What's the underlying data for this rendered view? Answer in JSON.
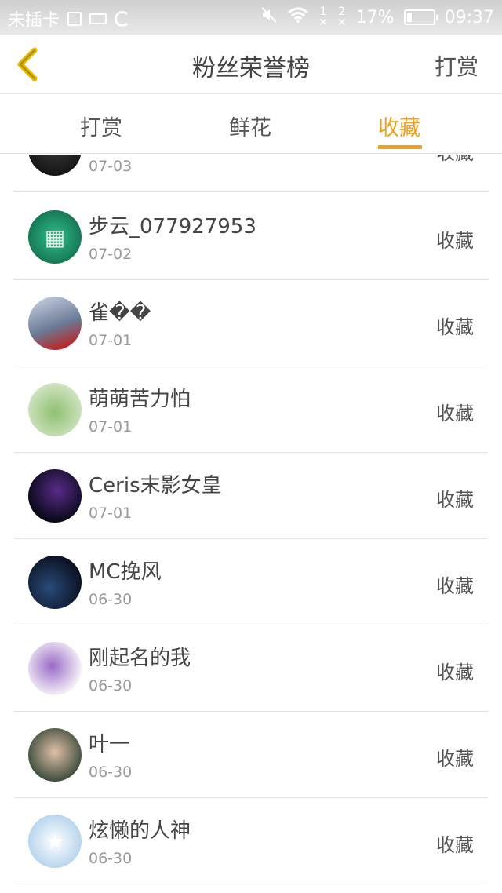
{
  "status_bar": {
    "carrier": "未插卡",
    "sim1": "1",
    "sim2": "2",
    "battery_percent_text": "17%",
    "battery_level": 0.17,
    "time": "09:37"
  },
  "header": {
    "back_icon": "chevron-left-icon",
    "title": "粉丝荣誉榜",
    "action": "打赏",
    "accent_color": "#f0a020"
  },
  "tabs": [
    {
      "label": "打赏",
      "active": false
    },
    {
      "label": "鲜花",
      "active": false
    },
    {
      "label": "收藏",
      "active": true
    }
  ],
  "list": [
    {
      "name": "",
      "date": "07-03",
      "action": "收藏"
    },
    {
      "name": "步云_077927953",
      "date": "07-02",
      "action": "收藏"
    },
    {
      "name": "雀��",
      "date": "07-01",
      "action": "收藏"
    },
    {
      "name": "萌萌苦力怕",
      "date": "07-01",
      "action": "收藏"
    },
    {
      "name": "Ceris末影女皇",
      "date": "07-01",
      "action": "收藏"
    },
    {
      "name": "MC挽风",
      "date": "06-30",
      "action": "收藏"
    },
    {
      "name": "刚起名的我",
      "date": "06-30",
      "action": "收藏"
    },
    {
      "name": "叶一",
      "date": "06-30",
      "action": "收藏"
    },
    {
      "name": "炫懒的人神",
      "date": "06-30",
      "action": "收藏"
    }
  ]
}
